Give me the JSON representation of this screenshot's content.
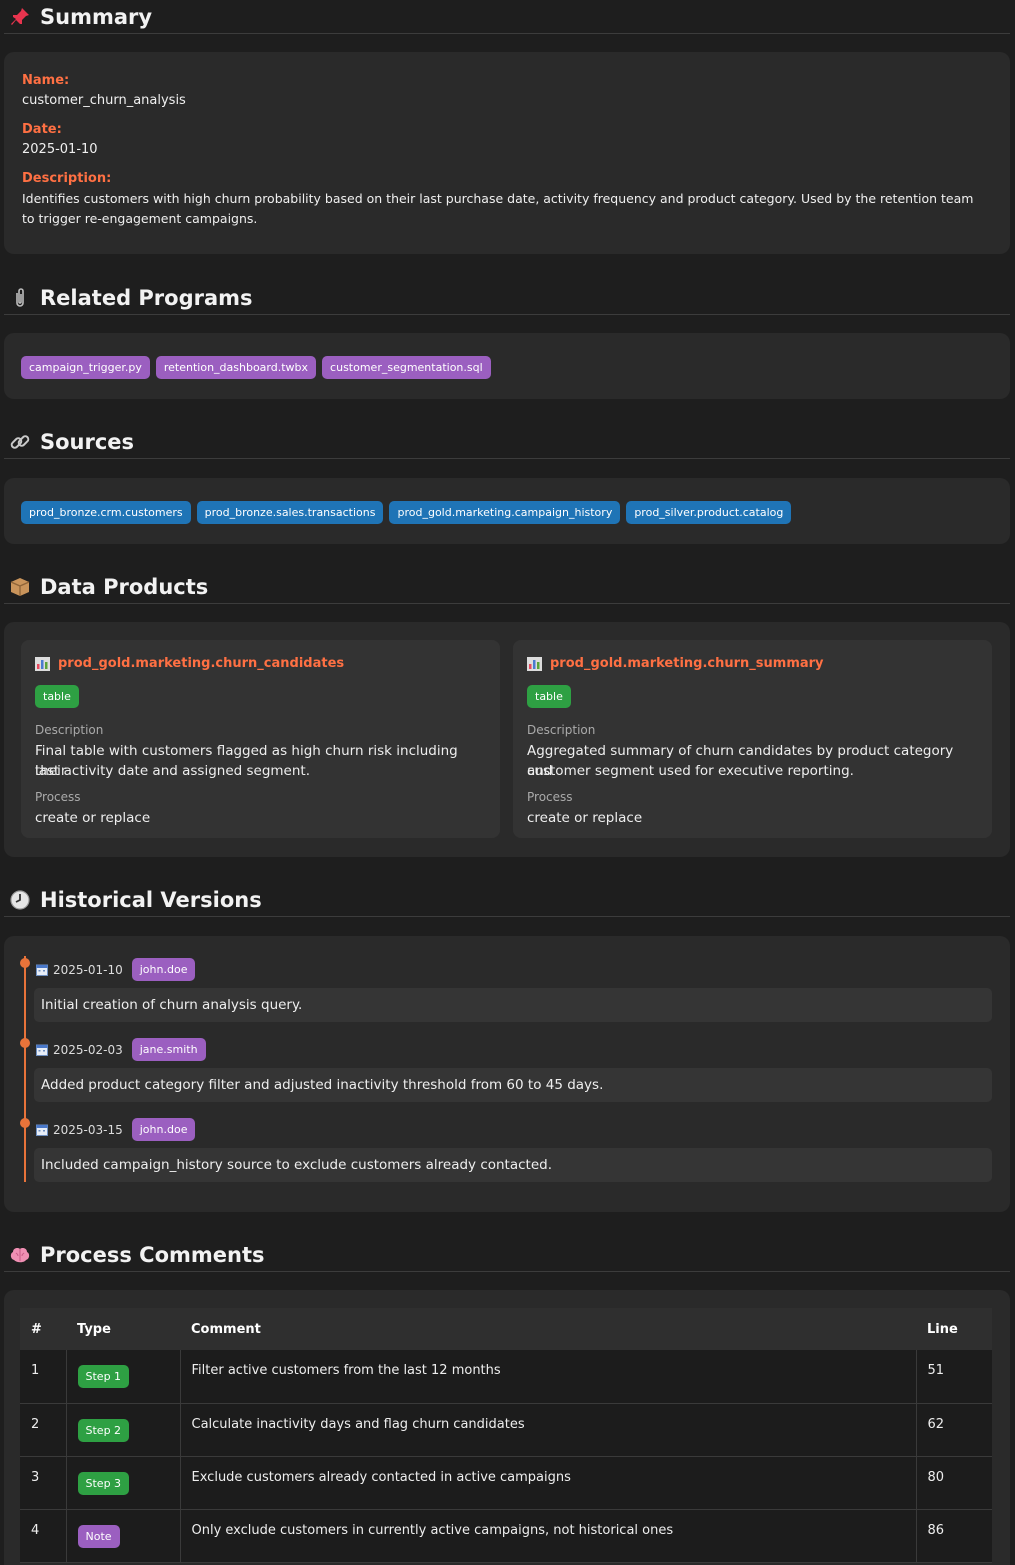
{
  "summary": {
    "title": "Summary",
    "name_label": "Name:",
    "name_value": "customer_churn_analysis",
    "date_label": "Date:",
    "date_value": "2025-01-10",
    "description_label": "Description:",
    "description_line1": "Identifies customers with high churn probability based on their last purchase date, activity frequency and product category. Used by the retention team",
    "description_line2": "to trigger re-engagement campaigns."
  },
  "related_programs": {
    "title": "Related Programs",
    "items": [
      "campaign_trigger.py",
      "retention_dashboard.twbx",
      "customer_segmentation.sql"
    ]
  },
  "sources": {
    "title": "Sources",
    "items": [
      "prod_bronze.crm.customers",
      "prod_bronze.sales.transactions",
      "prod_gold.marketing.campaign_history",
      "prod_silver.product.catalog"
    ]
  },
  "data_products": {
    "title": "Data Products",
    "items": [
      {
        "name": "prod_gold.marketing.churn_candidates",
        "type": "table",
        "description_label": "Description",
        "description_line1": "Final table with customers flagged as high churn risk including their",
        "description_line2": "last activity date and assigned segment.",
        "process_label": "Process",
        "process": "create or replace"
      },
      {
        "name": "prod_gold.marketing.churn_summary",
        "type": "table",
        "description_label": "Description",
        "description_line1": "Aggregated summary of churn candidates by product category and",
        "description_line2": "customer segment used for executive reporting.",
        "process_label": "Process",
        "process": "create or replace"
      }
    ]
  },
  "historical_versions": {
    "title": "Historical Versions",
    "items": [
      {
        "date": "2025-01-10",
        "author": "john.doe",
        "text": "Initial creation of churn analysis query."
      },
      {
        "date": "2025-02-03",
        "author": "jane.smith",
        "text": "Added product category filter and adjusted inactivity threshold from 60 to 45 days."
      },
      {
        "date": "2025-03-15",
        "author": "john.doe",
        "text": "Included campaign_history source to exclude customers already contacted."
      }
    ]
  },
  "process_comments": {
    "title": "Process Comments",
    "headers": [
      "#",
      "Type",
      "Comment",
      "Line"
    ],
    "rows": [
      {
        "num": "1",
        "type": "Step 1",
        "comment": "Filter active customers from the last 12 months",
        "line": "51"
      },
      {
        "num": "2",
        "type": "Step 2",
        "comment": "Calculate inactivity days and flag churn candidates",
        "line": "62"
      },
      {
        "num": "3",
        "type": "Step 3",
        "comment": "Exclude customers already contacted in active campaigns",
        "line": "80"
      },
      {
        "num": "4",
        "type": "Note",
        "comment": "Only exclude customers in currently active campaigns, not historical ones",
        "line": "86"
      }
    ]
  },
  "colors": {
    "accent": "#ff7043",
    "purple_tag": "#9b5fc0",
    "blue_tag": "#1f74b6",
    "green_tag": "#2ea043",
    "timeline": "#e8733a"
  }
}
